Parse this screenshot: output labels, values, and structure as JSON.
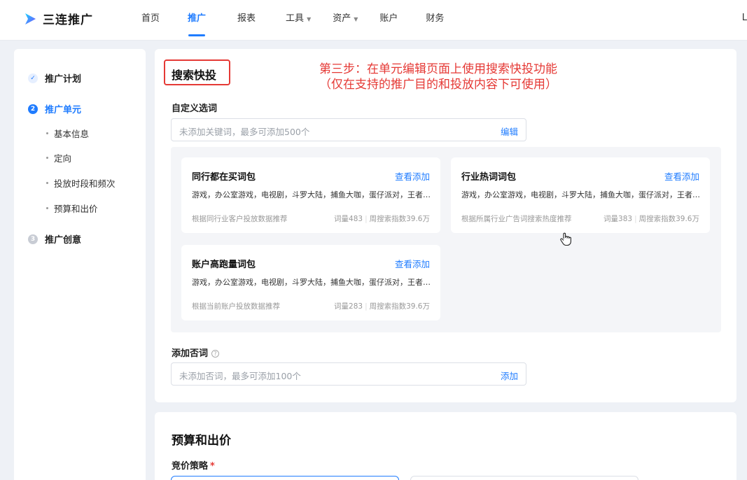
{
  "app": {
    "name": "三连推广",
    "right_mark": "L"
  },
  "nav": {
    "items": [
      {
        "label": "首页"
      },
      {
        "label": "推广"
      },
      {
        "label": "报表"
      },
      {
        "label": "工具"
      },
      {
        "label": "资产"
      },
      {
        "label": "账户"
      },
      {
        "label": "财务"
      }
    ],
    "active": "推广",
    "caret": "▼"
  },
  "sidebar": {
    "steps": [
      {
        "badge": "✓",
        "label": "推广计划",
        "state": "done"
      },
      {
        "badge": "2",
        "label": "推广单元",
        "state": "active"
      },
      {
        "badge": "3",
        "label": "推广创意",
        "state": "todo"
      }
    ],
    "substeps": [
      "基本信息",
      "定向",
      "投放时段和频次",
      "预算和出价"
    ]
  },
  "search_quick": {
    "title": "搜索快投",
    "annotation_line1": "第三步：在单元编辑页面上使用搜索快投功能",
    "annotation_line2": "（仅在支持的推广目的和投放内容下可使用）",
    "custom_words": {
      "label": "自定义选词",
      "placeholder": "未添加关键词，最多可添加500个",
      "action": "编辑"
    },
    "packs": [
      {
        "title": "同行都在买词包",
        "link": "查看添加",
        "words": "游戏，办公室游戏，电视剧，斗罗大陆，捕鱼大咖，蛋仔派对，王者荣耀",
        "source": "根据同行业客户投放数据推荐",
        "count": "词量483",
        "index": "周搜索指数39.6万"
      },
      {
        "title": "行业热词词包",
        "link": "查看添加",
        "words": "游戏，办公室游戏，电视剧，斗罗大陆，捕鱼大咖，蛋仔派对，王者荣耀",
        "source": "根据所属行业广告词搜索热度推荐",
        "count": "词量383",
        "index": "周搜索指数39.6万"
      },
      {
        "title": "账户高跑量词包",
        "link": "查看添加",
        "words": "游戏，办公室游戏，电视剧，斗罗大陆，捕鱼大咖，蛋仔派对，王者荣耀",
        "source": "根据当前账户投放数据推荐",
        "count": "词量283",
        "index": "周搜索指数39.6万"
      }
    ],
    "negative_words": {
      "label": "添加否词",
      "hint": "?",
      "placeholder": "未添加否词，最多可添加100个",
      "action": "添加"
    }
  },
  "budget": {
    "title": "预算和出价",
    "strategy_label": "竞价策略",
    "required_mark": "*"
  },
  "colors": {
    "accent": "#1f7cff",
    "annotation": "#e53935",
    "background": "#eef1f6"
  }
}
